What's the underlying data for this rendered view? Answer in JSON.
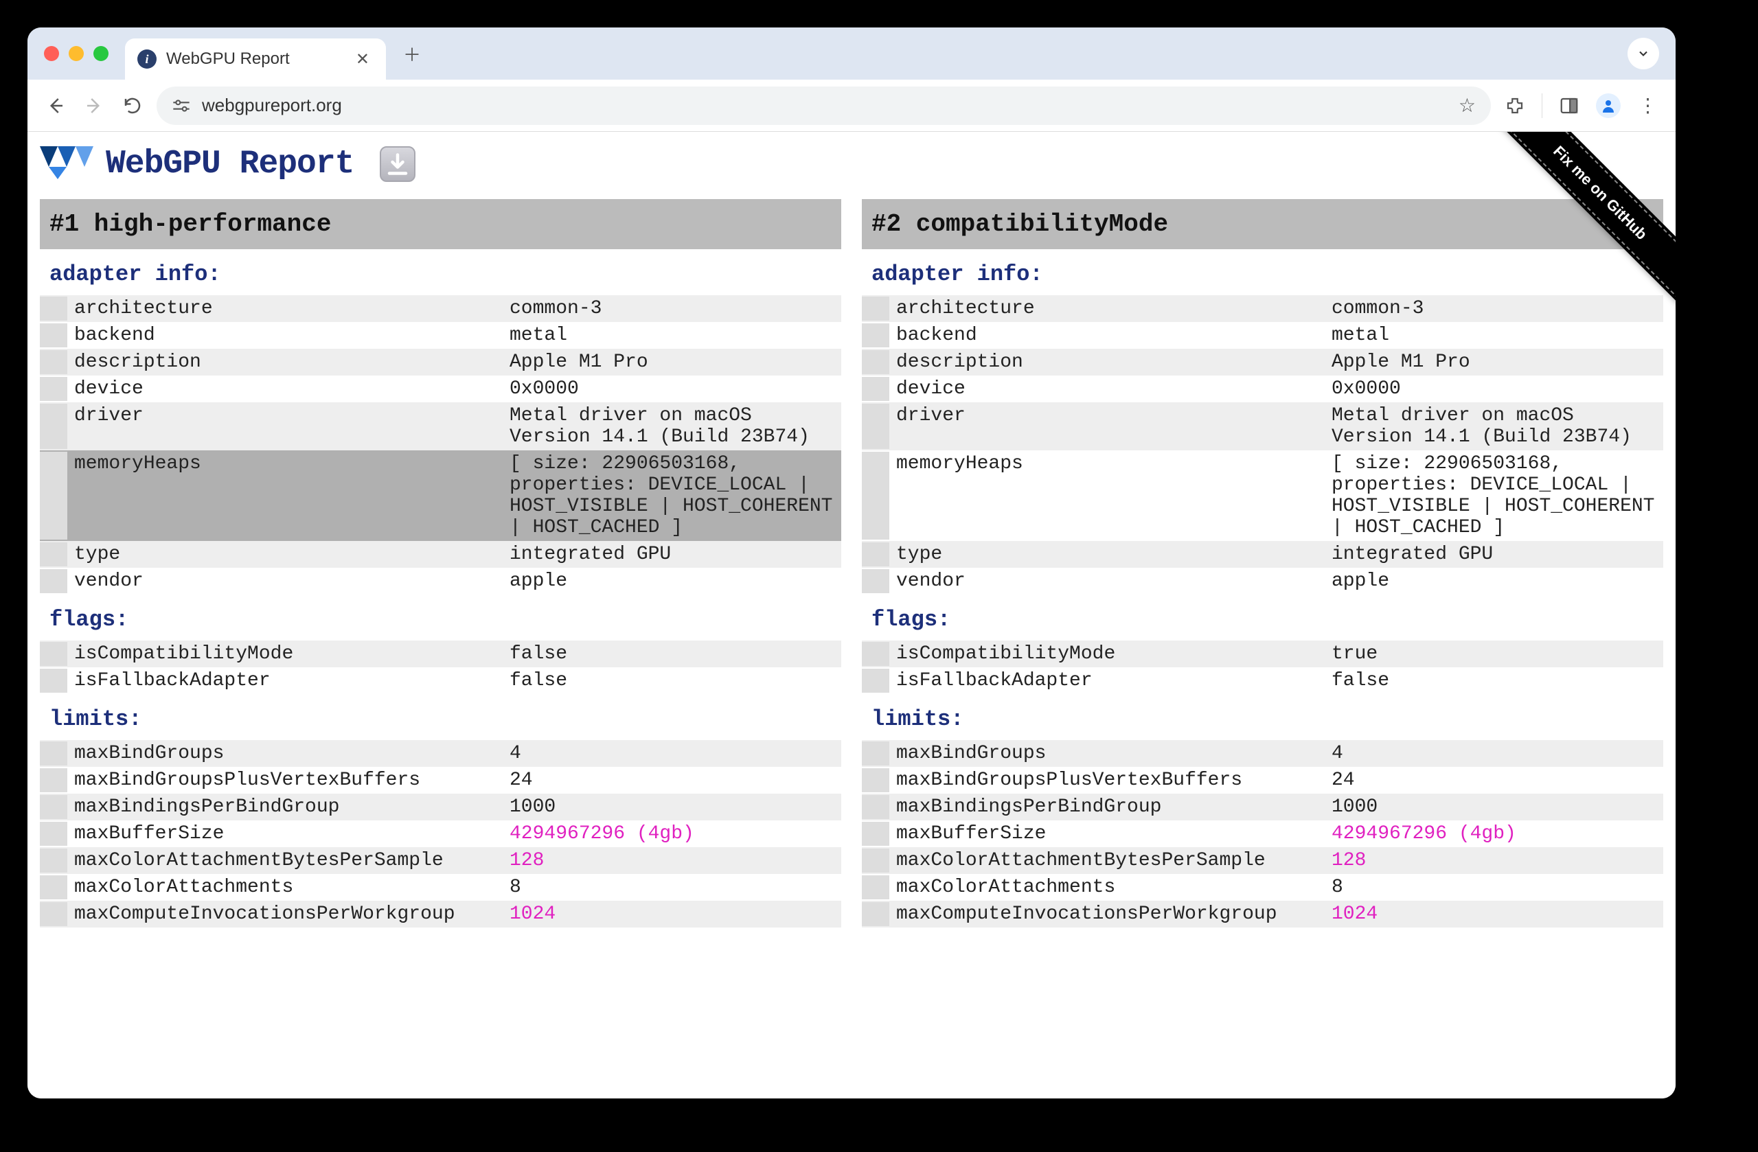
{
  "browser": {
    "tab_title": "WebGPU Report",
    "url": "webgpureport.org"
  },
  "page": {
    "title": "WebGPU Report",
    "github_ribbon": "Fix me on GitHub"
  },
  "panels": [
    {
      "title": "#1 high-performance",
      "sections": [
        {
          "title": "adapter info:",
          "rows": [
            {
              "key": "architecture",
              "val": "common-3"
            },
            {
              "key": "backend",
              "val": "metal"
            },
            {
              "key": "description",
              "val": "Apple M1 Pro"
            },
            {
              "key": "device",
              "val": "0x0000"
            },
            {
              "key": "driver",
              "val": "Metal driver on macOS Version 14.1 (Build 23B74)"
            },
            {
              "key": "memoryHeaps",
              "val": "[ size: 22906503168, properties: DEVICE_LOCAL | HOST_VISIBLE | HOST_COHERENT | HOST_CACHED ]",
              "highlight": true
            },
            {
              "key": "type",
              "val": "integrated GPU"
            },
            {
              "key": "vendor",
              "val": "apple"
            }
          ]
        },
        {
          "title": "flags:",
          "rows": [
            {
              "key": "isCompatibilityMode",
              "val": "false"
            },
            {
              "key": "isFallbackAdapter",
              "val": "false"
            }
          ]
        },
        {
          "title": "limits:",
          "rows": [
            {
              "key": "maxBindGroups",
              "val": "4"
            },
            {
              "key": "maxBindGroupsPlusVertexBuffers",
              "val": "24"
            },
            {
              "key": "maxBindingsPerBindGroup",
              "val": "1000"
            },
            {
              "key": "maxBufferSize",
              "val": "4294967296 (4gb)",
              "special": true
            },
            {
              "key": "maxColorAttachmentBytesPerSample",
              "val": "128",
              "special": true
            },
            {
              "key": "maxColorAttachments",
              "val": "8"
            },
            {
              "key": "maxComputeInvocationsPerWorkgroup",
              "val": "1024",
              "special": true
            }
          ]
        }
      ]
    },
    {
      "title": "#2 compatibilityMode",
      "sections": [
        {
          "title": "adapter info:",
          "rows": [
            {
              "key": "architecture",
              "val": "common-3"
            },
            {
              "key": "backend",
              "val": "metal"
            },
            {
              "key": "description",
              "val": "Apple M1 Pro"
            },
            {
              "key": "device",
              "val": "0x0000"
            },
            {
              "key": "driver",
              "val": "Metal driver on macOS Version 14.1 (Build 23B74)"
            },
            {
              "key": "memoryHeaps",
              "val": "[ size: 22906503168, properties: DEVICE_LOCAL | HOST_VISIBLE | HOST_COHERENT | HOST_CACHED ]"
            },
            {
              "key": "type",
              "val": "integrated GPU"
            },
            {
              "key": "vendor",
              "val": "apple"
            }
          ]
        },
        {
          "title": "flags:",
          "rows": [
            {
              "key": "isCompatibilityMode",
              "val": "true"
            },
            {
              "key": "isFallbackAdapter",
              "val": "false"
            }
          ]
        },
        {
          "title": "limits:",
          "rows": [
            {
              "key": "maxBindGroups",
              "val": "4"
            },
            {
              "key": "maxBindGroupsPlusVertexBuffers",
              "val": "24"
            },
            {
              "key": "maxBindingsPerBindGroup",
              "val": "1000"
            },
            {
              "key": "maxBufferSize",
              "val": "4294967296 (4gb)",
              "special": true
            },
            {
              "key": "maxColorAttachmentBytesPerSample",
              "val": "128",
              "special": true
            },
            {
              "key": "maxColorAttachments",
              "val": "8"
            },
            {
              "key": "maxComputeInvocationsPerWorkgroup",
              "val": "1024",
              "special": true
            }
          ]
        }
      ]
    }
  ]
}
